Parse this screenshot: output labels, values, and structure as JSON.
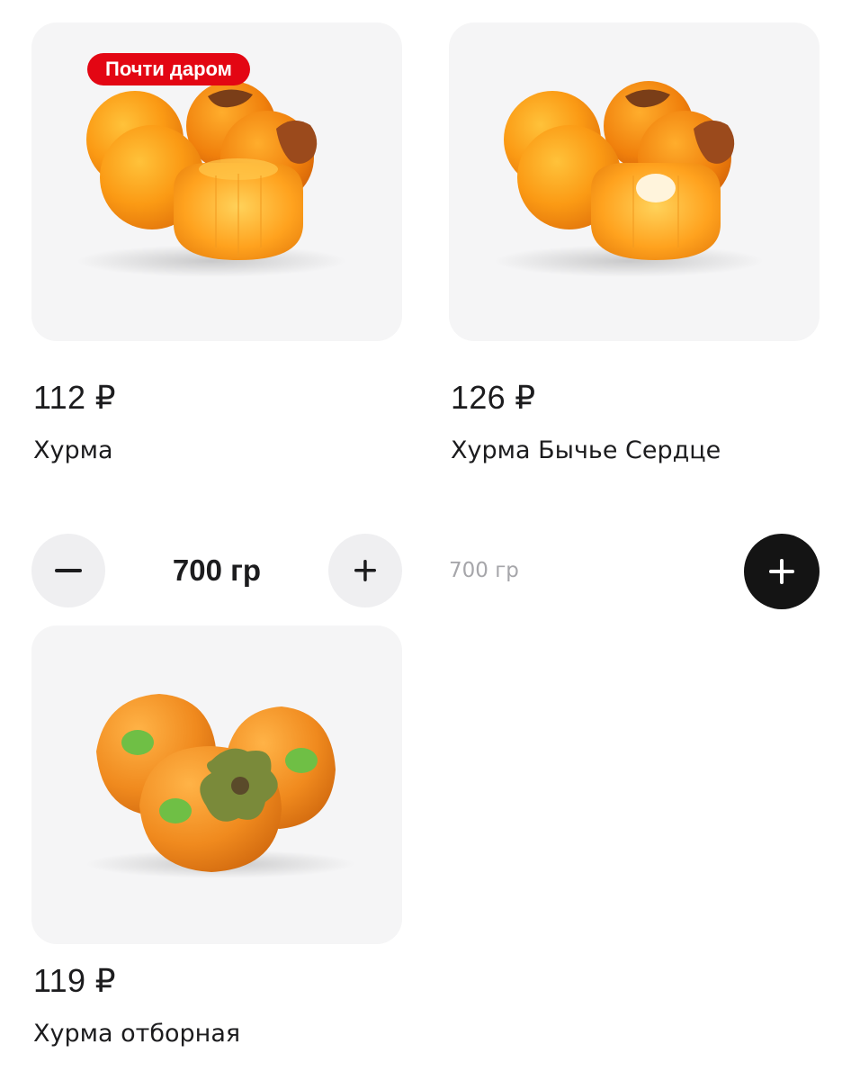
{
  "colors": {
    "image_bg": "#f5f5f6",
    "promo_badge": "#e30613",
    "button_light": "#efeff1",
    "button_dark": "#141414",
    "hint_text": "#a6a6aa"
  },
  "products": [
    {
      "badge": "Почти даром",
      "price": "112 ₽",
      "name": "Хурма",
      "image_icon": "persimmon-pile-icon",
      "stepper": {
        "value": "700 гр",
        "minus_icon": "minus-icon",
        "plus_icon": "plus-icon"
      }
    },
    {
      "price": "126 ₽",
      "name": "Хурма Бычье Сердце",
      "image_icon": "persimmon-pile-icon",
      "add": {
        "weight_hint": "700 гр",
        "plus_icon": "plus-icon"
      }
    },
    {
      "price": "119 ₽",
      "name": "Хурма отборная",
      "image_icon": "persimmon-trio-icon"
    }
  ]
}
